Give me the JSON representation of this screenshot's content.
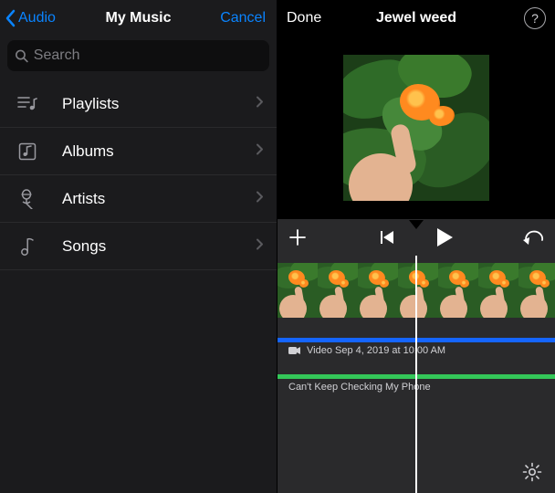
{
  "left": {
    "back_label": "Audio",
    "title": "My Music",
    "cancel_label": "Cancel",
    "search_placeholder": "Search",
    "rows": [
      {
        "label": "Playlists"
      },
      {
        "label": "Albums"
      },
      {
        "label": "Artists"
      },
      {
        "label": "Songs"
      }
    ]
  },
  "right": {
    "done_label": "Done",
    "title": "Jewel weed",
    "help_label": "?",
    "video_clip_label": "Video Sep 4, 2019 at 10:00 AM",
    "audio_clip_label": "Can't Keep Checking My Phone"
  }
}
